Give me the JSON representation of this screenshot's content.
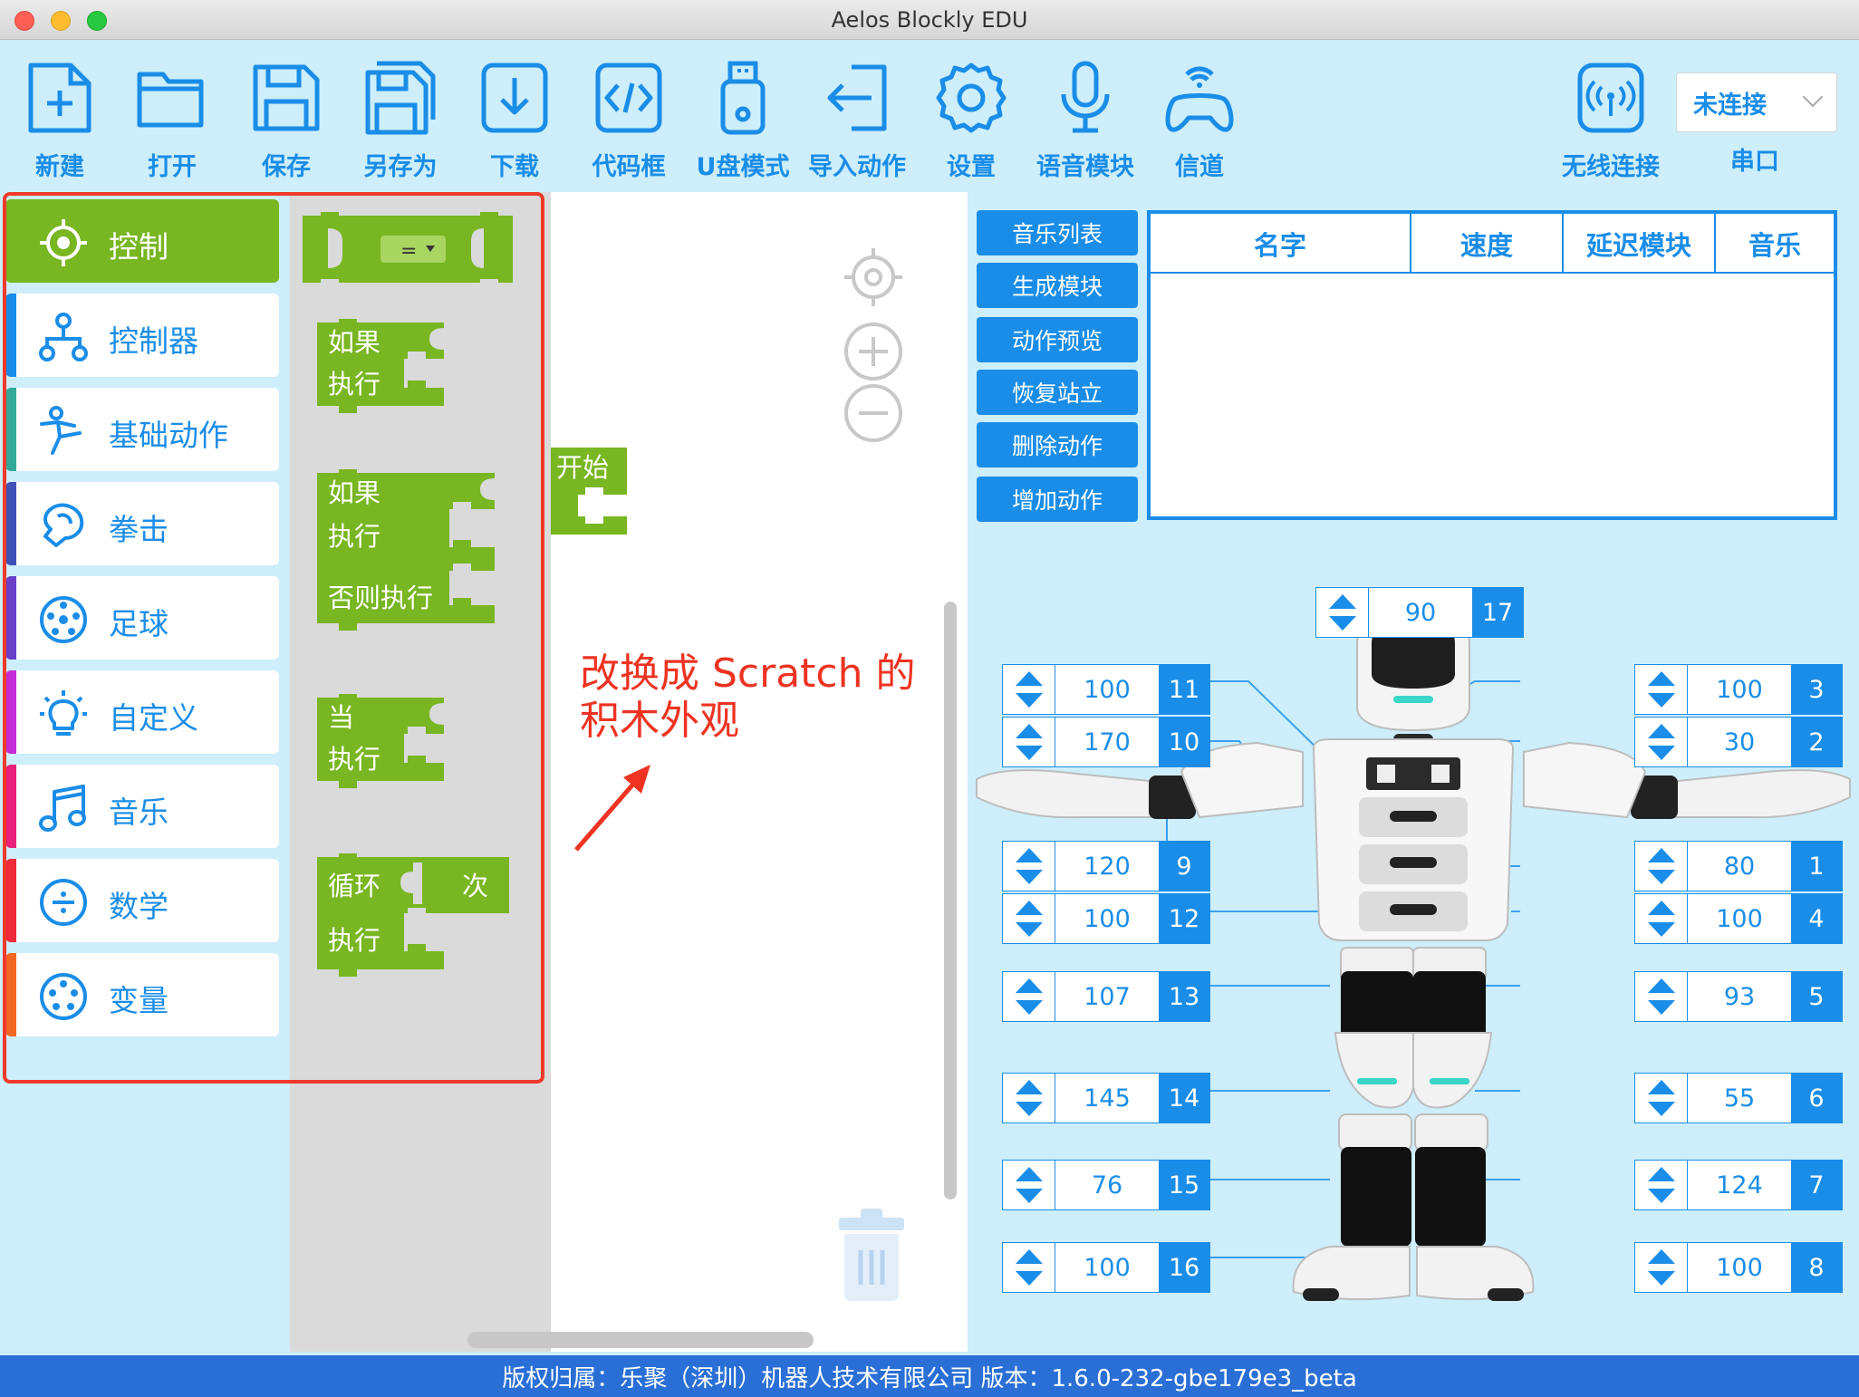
{
  "window": {
    "title": "Aelos Blockly EDU"
  },
  "toolbar": {
    "new": "新建",
    "open": "打开",
    "save": "保存",
    "save_as": "另存为",
    "download": "下载",
    "code_box": "代码框",
    "usb_mode": "U盘模式",
    "import_action": "导入动作",
    "settings": "设置",
    "voice_module": "语音模块",
    "channel": "信道",
    "wireless": "无线连接",
    "port_label": "串口",
    "port_value": "未连接"
  },
  "categories": [
    {
      "label": "控制",
      "color": "#78b622"
    },
    {
      "label": "控制器",
      "color": "#1a8de8"
    },
    {
      "label": "基础动作",
      "color": "#33a99a"
    },
    {
      "label": "拳击",
      "color": "#3f51b5"
    },
    {
      "label": "足球",
      "color": "#6a3fc8"
    },
    {
      "label": "自定义",
      "color": "#c62ad6"
    },
    {
      "label": "音乐",
      "color": "#e8217a"
    },
    {
      "label": "数学",
      "color": "#ee2a3c"
    },
    {
      "label": "变量",
      "color": "#f26522"
    }
  ],
  "blocks": {
    "compare_op": "=",
    "if": "如果",
    "do": "执行",
    "else_do": "否则执行",
    "while": "当",
    "repeat": "循环",
    "times": "次",
    "start": "开始"
  },
  "annotation": "改换成 Scratch 的\n积木外观",
  "action_buttons": [
    "音乐列表",
    "生成模块",
    "动作预览",
    "恢复站立",
    "删除动作",
    "增加动作"
  ],
  "table_headers": [
    "名字",
    "速度",
    "延迟模块",
    "音乐"
  ],
  "servos": {
    "s17": {
      "value": "90",
      "id": "17"
    },
    "s11": {
      "value": "100",
      "id": "11"
    },
    "s10": {
      "value": "170",
      "id": "10"
    },
    "s9": {
      "value": "120",
      "id": "9"
    },
    "s12": {
      "value": "100",
      "id": "12"
    },
    "s13": {
      "value": "107",
      "id": "13"
    },
    "s14": {
      "value": "145",
      "id": "14"
    },
    "s15": {
      "value": "76",
      "id": "15"
    },
    "s16": {
      "value": "100",
      "id": "16"
    },
    "s3": {
      "value": "100",
      "id": "3"
    },
    "s2": {
      "value": "30",
      "id": "2"
    },
    "s1": {
      "value": "80",
      "id": "1"
    },
    "s4": {
      "value": "100",
      "id": "4"
    },
    "s5": {
      "value": "93",
      "id": "5"
    },
    "s6": {
      "value": "55",
      "id": "6"
    },
    "s7": {
      "value": "124",
      "id": "7"
    },
    "s8": {
      "value": "100",
      "id": "8"
    }
  },
  "status": "版权归属：乐聚（深圳）机器人技术有限公司 版本：1.6.0-232-gbe179e3_beta",
  "colors": {
    "accent": "#1a8de8",
    "block_green": "#78b622",
    "annotation_red": "#ee3322",
    "status_bar": "#2a6fd6"
  }
}
